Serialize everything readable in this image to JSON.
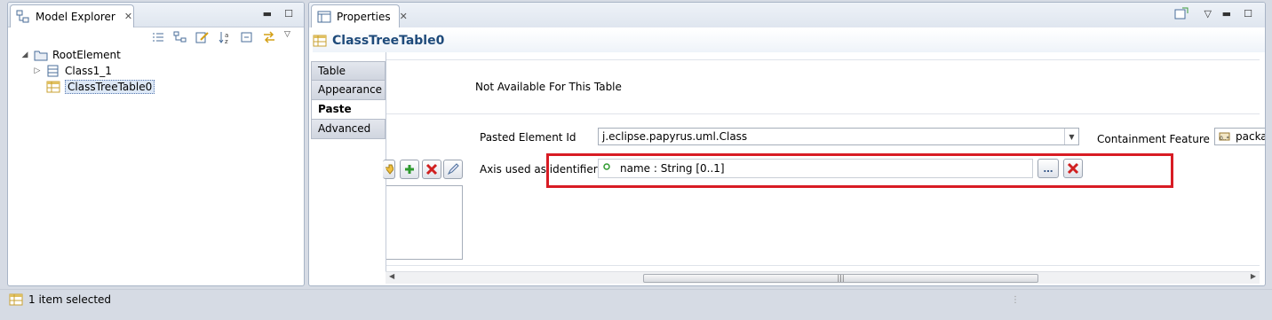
{
  "model_explorer": {
    "tab_label": "Model Explorer",
    "tree": [
      {
        "label": "RootElement"
      },
      {
        "label": "Class1_1"
      },
      {
        "label": "ClassTreeTable0"
      }
    ]
  },
  "properties": {
    "tab_label": "Properties",
    "title": "ClassTreeTable0",
    "side_tabs": [
      "Table",
      "Appearance",
      "Paste",
      "Advanced"
    ],
    "active_side_tab": "Paste",
    "not_available_text": "Not Available For This Table",
    "pasted_element_id_label": "Pasted Element Id",
    "pasted_element_id_value": "j.eclipse.papyrus.uml.Class",
    "containment_feature_label": "Containment Feature",
    "containment_feature_value": "packa",
    "axis_identifier_label": "Axis used as identifier",
    "axis_identifier_value": "name : String [0..1]",
    "browse_glyph": "…"
  },
  "status_bar": {
    "text": "1 item selected"
  },
  "colors": {
    "highlight_border": "#d81c24",
    "title_text": "#1e4a7a"
  }
}
